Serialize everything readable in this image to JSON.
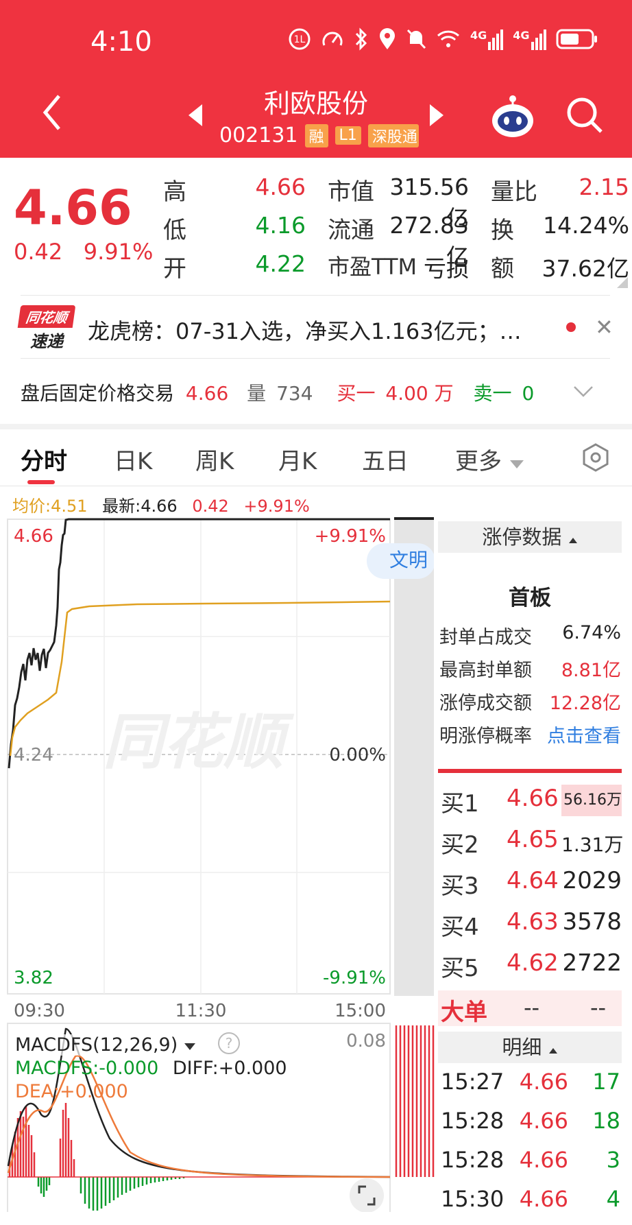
{
  "status": {
    "time": "4:10",
    "icons": [
      "hd-icon",
      "speed-icon",
      "bluetooth-icon",
      "location-icon",
      "mute-icon",
      "wifi-icon",
      "4g-signal-icon",
      "4g-signal-icon",
      "battery-icon"
    ],
    "network_1": "4G",
    "network_2": "4G"
  },
  "header": {
    "title": "利欧股份",
    "code": "002131",
    "badges": [
      "融",
      "L1",
      "深股通"
    ]
  },
  "quote": {
    "price": "4.66",
    "change": "0.42",
    "change_pct": "9.91%",
    "high_label": "高",
    "high": "4.66",
    "low_label": "低",
    "low": "4.16",
    "open_label": "开",
    "open": "4.22",
    "mcap_label": "市值",
    "mcap": "315.56亿",
    "float_label": "流通",
    "float": "272.83亿",
    "pe_label": "市盈TTM",
    "pe": "亏损",
    "vr_label": "量比",
    "vr": "2.15",
    "turn_label": "换",
    "turn": "14.24%",
    "amt_label": "额",
    "amt": "37.62亿"
  },
  "news": {
    "logo_top": "同花顺",
    "logo_bottom": "速递",
    "text": "龙虎榜：07-31入选，净买入1.163亿元；…"
  },
  "after_hours": {
    "label": "盘后固定价格交易",
    "price": "4.66",
    "vol_label": "量",
    "vol": "734",
    "buy_label": "买一",
    "buy": "4.00 万",
    "sell_label": "卖一",
    "sell": "0"
  },
  "tabs": [
    "分时",
    "日K",
    "周K",
    "月K",
    "五日",
    "更多"
  ],
  "legend": {
    "avg": "均价:4.51",
    "last": "最新:4.66",
    "chg": "0.42",
    "pct": "+9.91%"
  },
  "axis": {
    "top": "4.66",
    "top_pct": "+9.91%",
    "mid": "4.24",
    "mid_pct": "0.00%",
    "bottom": "3.82",
    "bottom_pct": "-9.91%",
    "t1": "09:30",
    "t2": "11:30",
    "t3": "15:00",
    "wm": "同花顺",
    "civil": "文明"
  },
  "macd": {
    "name": "MACDFS(12,26,9)",
    "help": "?",
    "max": "0.08",
    "macdfs": "MACDFS:-0.000",
    "diff": "DIFF:+0.000",
    "dea": "DEA:+0.000"
  },
  "limit_panel": {
    "title": "涨停数据",
    "board": "首板",
    "rows": [
      {
        "label": "封单占成交",
        "value": "6.74%"
      },
      {
        "label": "最高封单额",
        "value": "8.81亿"
      },
      {
        "label": "涨停成交额",
        "value": "12.28亿"
      },
      {
        "label": "明涨停概率",
        "value": "点击查看"
      }
    ]
  },
  "order_book": [
    {
      "label": "买1",
      "price": "4.66",
      "vol": "56.16万"
    },
    {
      "label": "买2",
      "price": "4.65",
      "vol": "1.31万"
    },
    {
      "label": "买3",
      "price": "4.64",
      "vol": "2029"
    },
    {
      "label": "买4",
      "price": "4.63",
      "vol": "3578"
    },
    {
      "label": "买5",
      "price": "4.62",
      "vol": "2722"
    }
  ],
  "big_order": {
    "label": "大单",
    "v1": "--",
    "v2": "--"
  },
  "detail": {
    "title": "明细",
    "rows": [
      {
        "time": "15:27",
        "price": "4.66",
        "vol": "17"
      },
      {
        "time": "15:28",
        "price": "4.66",
        "vol": "18"
      },
      {
        "time": "15:28",
        "price": "4.66",
        "vol": "3"
      },
      {
        "time": "15:30",
        "price": "4.66",
        "vol": "4"
      }
    ]
  },
  "colors": {
    "brand": "#ef3340",
    "up": "#e5303b",
    "down": "#0a9a2a",
    "avg_line": "#e0a020",
    "price_line": "#222222",
    "link": "#2f7ee0"
  }
}
